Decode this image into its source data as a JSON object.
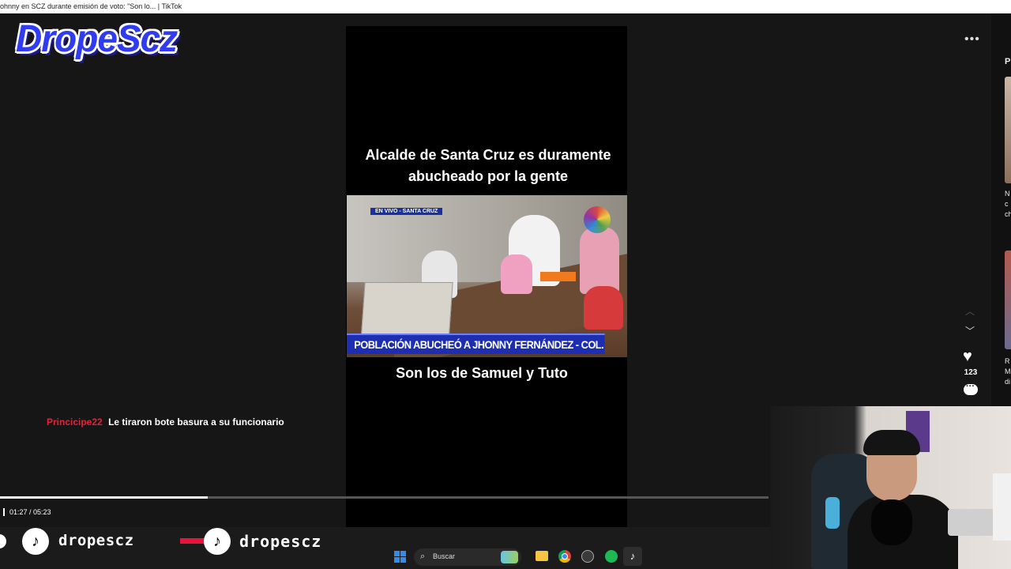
{
  "window": {
    "title": "ohnny en SCZ durante emisión de voto: \"Son lo... | TikTok"
  },
  "overlay": {
    "logo_text": "DropeScz"
  },
  "video": {
    "headline": "Alcalde de Santa Cruz es duramente abucheado por la gente",
    "live_tag": "EN VIVO - SANTA CRUZ",
    "lower_third": "POBLACIÓN ABUCHEÓ A JHONNY FERNÁNDEZ - COL. VILLA FÁTIMA",
    "caption": "Son los de Samuel y Tuto"
  },
  "actions": {
    "more_icon": "more-horizontal-icon",
    "like_count": "123"
  },
  "right_panel": {
    "heading_fragment": "P",
    "item1_fragment": "N\nc\nch",
    "item2_fragment": "R\nM\ndi"
  },
  "chat": {
    "user": "Princicipe22",
    "message": "Le tiraron bote basura a su funcionario"
  },
  "player": {
    "time": "01:27 / 05:23",
    "progress": 0.27
  },
  "socials": [
    {
      "handle": "dropescz"
    },
    {
      "handle": "dropescz"
    }
  ],
  "taskbar": {
    "search_placeholder": "Buscar"
  },
  "colors": {
    "chat_user": "#e0243a",
    "lower_third_bg": "#1d2fb0",
    "logo": "#2f3cf0"
  }
}
